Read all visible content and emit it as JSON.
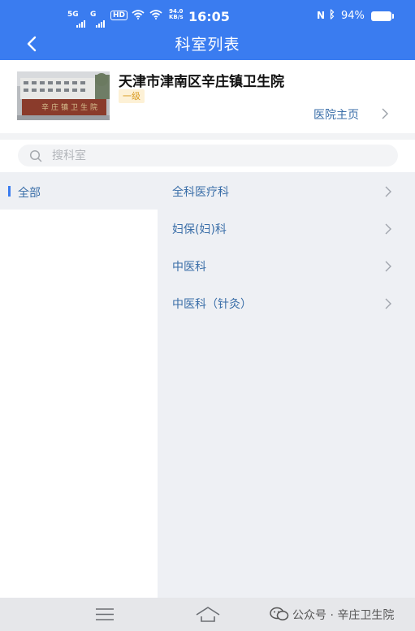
{
  "status_bar": {
    "signal1": "5G",
    "signal2": "G",
    "hd": "HD",
    "net_speed_value": "94.0",
    "net_speed_unit": "KB/s",
    "time": "16:05",
    "battery": "94%"
  },
  "header": {
    "title": "科室列表"
  },
  "hospital": {
    "name": "天津市津南区辛庄镇卫生院",
    "level": "一级",
    "home_link": "医院主页",
    "sign_text": "辛庄镇卫生院"
  },
  "search": {
    "placeholder": "搜科室"
  },
  "categories": [
    {
      "label": "全部",
      "selected": true
    }
  ],
  "departments": [
    {
      "label": "全科医疗科"
    },
    {
      "label": "妇保(妇)科"
    },
    {
      "label": "中医科"
    },
    {
      "label": "中医科（针灸）"
    }
  ],
  "watermark": "公众号 · 辛庄卫生院",
  "colors": {
    "primary": "#3a7cf0",
    "link": "#3a6ea8",
    "level_bg": "#fdf1d6",
    "level_text": "#d99a20",
    "panel_bg": "#eef0f4"
  }
}
